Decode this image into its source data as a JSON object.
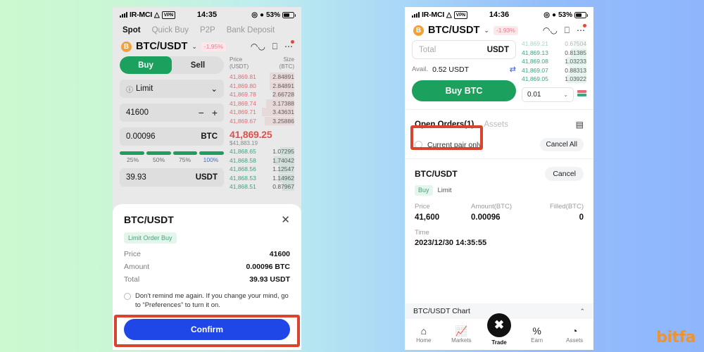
{
  "background": {
    "from": "#cdf9cf",
    "to": "#8fb6fc"
  },
  "watermark": "bitfa",
  "left_phone": {
    "status": {
      "carrier": "IR-MCI",
      "wifi": "▾",
      "vpn": "VPN",
      "time": "14:35",
      "battery_pct": "53%",
      "location_icon": "◎",
      "alarm_icon": "⏰"
    },
    "top_tabs": [
      {
        "label": "Spot",
        "active": true
      },
      {
        "label": "Quick Buy",
        "active": false
      },
      {
        "label": "P2P",
        "active": false
      },
      {
        "label": "Bank Deposit",
        "active": false
      }
    ],
    "pair": {
      "symbol": "B",
      "name": "BTC/USDT",
      "chevron": "⌄",
      "change": "-1.95%"
    },
    "header_icons": [
      "candlestick-icon",
      "calculator-icon",
      "more-icon"
    ],
    "side_toggle": {
      "buy": "Buy",
      "sell": "Sell",
      "active": "Buy"
    },
    "order_type": {
      "label": "Limit",
      "info": "ⓘ",
      "chevron": "⌄"
    },
    "price_field": {
      "value": "41600",
      "minus": "−",
      "plus": "+"
    },
    "amount_field": {
      "value": "0.00096",
      "unit": "BTC"
    },
    "percents": [
      {
        "label": "25%",
        "active": false
      },
      {
        "label": "50%",
        "active": false
      },
      {
        "label": "75%",
        "active": false
      },
      {
        "label": "100%",
        "active": true
      }
    ],
    "total_field": {
      "value": "39.93",
      "unit": "USDT"
    },
    "orderbook": {
      "col_price": "Price",
      "col_price_unit": "(USDT)",
      "col_size": "Size",
      "col_size_unit": "(BTC)",
      "asks": [
        {
          "price": "41,869.81",
          "size": "2.84891",
          "bar": 38
        },
        {
          "price": "41,869.80",
          "size": "2.84891",
          "bar": 38
        },
        {
          "price": "41,869.78",
          "size": "2.66728",
          "bar": 34
        },
        {
          "price": "41,869.74",
          "size": "3.17388",
          "bar": 44
        },
        {
          "price": "41,869.71",
          "size": "3.43631",
          "bar": 50
        },
        {
          "price": "41,869.67",
          "size": "3.25886",
          "bar": 46
        }
      ],
      "mid_price": "41,869.25",
      "mid_usd": "$41,883.19",
      "bids": [
        {
          "price": "41,868.65",
          "size": "1.07295",
          "bar": 22
        },
        {
          "price": "41,868.58",
          "size": "1.74042",
          "bar": 32
        },
        {
          "price": "41,868.56",
          "size": "1.12547",
          "bar": 24
        },
        {
          "price": "41,868.53",
          "size": "1.14962",
          "bar": 25
        },
        {
          "price": "41,868.51",
          "size": "0.87967",
          "bar": 18
        }
      ]
    },
    "modal": {
      "title": "BTC/USDT",
      "close": "✕",
      "chip": "Limit Order Buy",
      "rows": [
        {
          "key": "Price",
          "value": "41600"
        },
        {
          "key": "Amount",
          "value": "0.00096 BTC"
        },
        {
          "key": "Total",
          "value": "39.93 USDT"
        }
      ],
      "remind_text": "Don't remind me again. If you change your mind, go to “Preferences” to turn it on.",
      "confirm_label": "Confirm"
    },
    "highlight_color": "#d9442f"
  },
  "right_phone": {
    "status": {
      "carrier": "IR-MCI",
      "wifi": "▾",
      "vpn": "VPN",
      "time": "14:36",
      "battery_pct": "53%",
      "location_icon": "◎",
      "alarm_icon": "⏰"
    },
    "pair": {
      "symbol": "B",
      "name": "BTC/USDT",
      "chevron": "⌄",
      "change": "-1.93%"
    },
    "header_icons": [
      "candlestick-icon",
      "calculator-icon",
      "more-icon"
    ],
    "total_field": {
      "placeholder": "Total",
      "unit": "USDT"
    },
    "avail": {
      "label": "Avail.",
      "value": "0.52 USDT",
      "swap_icon": "⇄"
    },
    "buy_button": "Buy BTC",
    "depth": {
      "value": "0.01",
      "chevron": "⌄"
    },
    "orderbook_bids": [
      {
        "price": "41,869.21",
        "size": "0.67504"
      },
      {
        "price": "41,869.13",
        "size": "0.81385"
      },
      {
        "price": "41,869.08",
        "size": "1.03233"
      },
      {
        "price": "41,869.07",
        "size": "0.88313"
      },
      {
        "price": "41,869.05",
        "size": "1.03922"
      }
    ],
    "tabs": [
      {
        "label": "Open Orders(1)",
        "active": true
      },
      {
        "label": "Assets",
        "active": false
      }
    ],
    "list_icon": "▤",
    "current_pair_only": "Current pair only",
    "cancel_all": "Cancel All",
    "order": {
      "pair": "BTC/USDT",
      "cancel": "Cancel",
      "side_tag": "Buy",
      "type_tag": "Limit",
      "cells": [
        {
          "key": "Price",
          "value": "41,600"
        },
        {
          "key": "Amount(BTC)",
          "value": "0.00096"
        },
        {
          "key": "Filled(BTC)",
          "value": "0"
        }
      ],
      "time_label": "Time",
      "time_value": "2023/12/30 14:35:55"
    },
    "chart_bar": {
      "label": "BTC/USDT Chart",
      "chevron": "⌃"
    },
    "bottom_nav": [
      {
        "label": "Home",
        "icon": "⌂"
      },
      {
        "label": "Markets",
        "icon": "↗"
      },
      {
        "label": "Trade",
        "icon": "✖"
      },
      {
        "label": "Earn",
        "icon": "%"
      },
      {
        "label": "Assets",
        "icon": "◔"
      }
    ],
    "highlight_color": "#d9442f"
  }
}
